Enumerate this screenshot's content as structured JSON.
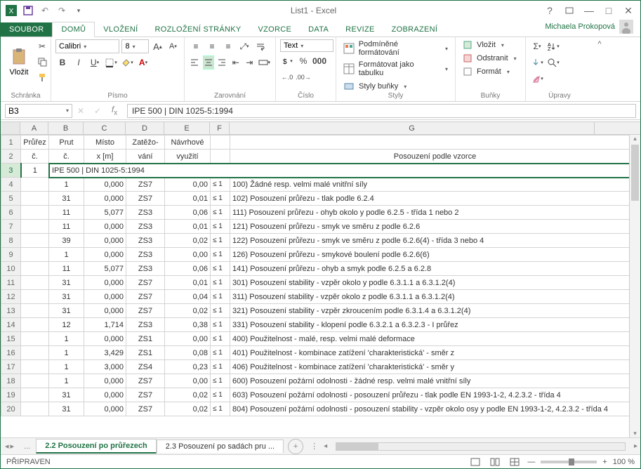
{
  "title": "List1 - Excel",
  "user": "Michaela Prokopová",
  "tabs": {
    "file": "SOUBOR",
    "home": "DOMŮ",
    "insert": "VLOŽENÍ",
    "layout": "ROZLOŽENÍ STRÁNKY",
    "formulas": "VZORCE",
    "data": "DATA",
    "review": "REVIZE",
    "view": "ZOBRAZENÍ"
  },
  "ribbon": {
    "clipboard": {
      "paste": "Vložit",
      "label": "Schránka"
    },
    "font": {
      "name": "Calibri",
      "size": "8",
      "label": "Písmo"
    },
    "align": {
      "label": "Zarovnání"
    },
    "number": {
      "format": "Text",
      "label": "Číslo"
    },
    "styles": {
      "cf": "Podmíněné formátování",
      "tbl": "Formátovat jako tabulku",
      "cell": "Styly buňky",
      "label": "Styly"
    },
    "cells": {
      "ins": "Vložit",
      "del": "Odstranit",
      "fmt": "Formát",
      "label": "Buňky"
    },
    "editing": {
      "label": "Úpravy"
    }
  },
  "namebox": "B3",
  "formula": "IPE 500 | DIN 1025-5:1994",
  "cols": [
    "A",
    "B",
    "C",
    "D",
    "E",
    "F",
    "G"
  ],
  "colW": {
    "A": 40,
    "B": 50,
    "C": 60,
    "D": 55,
    "E": 65,
    "F": 28,
    "G": 520
  },
  "hdr1": {
    "A": "Průřez",
    "B": "Prut",
    "C": "Místo",
    "D": "Zatěžo-",
    "E": "Návrhové",
    "G": ""
  },
  "hdr2": {
    "A": "č.",
    "B": "č.",
    "C": "x [m]",
    "D": "vání",
    "E": "využití",
    "G": "Posouzení podle vzorce"
  },
  "row3": {
    "A": "1",
    "merged": "IPE 500 | DIN 1025-5:1994"
  },
  "rows": [
    {
      "n": 4,
      "B": "1",
      "C": "0,000",
      "D": "ZS7",
      "E": "0,00",
      "F": "≤ 1",
      "G": "100) Žádné resp. velmi malé vnitřní síly"
    },
    {
      "n": 5,
      "B": "31",
      "C": "0,000",
      "D": "ZS7",
      "E": "0,01",
      "F": "≤ 1",
      "G": "102) Posouzení průřezu - tlak podle 6.2.4"
    },
    {
      "n": 6,
      "B": "11",
      "C": "5,077",
      "D": "ZS3",
      "E": "0,06",
      "F": "≤ 1",
      "G": "111) Posouzení průřezu - ohyb okolo y podle 6.2.5 - třída 1 nebo 2"
    },
    {
      "n": 7,
      "B": "11",
      "C": "0,000",
      "D": "ZS3",
      "E": "0,01",
      "F": "≤ 1",
      "G": "121) Posouzení průřezu - smyk ve směru z podle 6.2.6"
    },
    {
      "n": 8,
      "B": "39",
      "C": "0,000",
      "D": "ZS3",
      "E": "0,02",
      "F": "≤ 1",
      "G": "122) Posouzení průřezu - smyk ve směru z podle 6.2.6(4) - třída 3 nebo 4"
    },
    {
      "n": 9,
      "B": "1",
      "C": "0,000",
      "D": "ZS3",
      "E": "0,00",
      "F": "≤ 1",
      "G": "126) Posouzení průřezu - smykové boulení podle 6.2.6(6)"
    },
    {
      "n": 10,
      "B": "11",
      "C": "5,077",
      "D": "ZS3",
      "E": "0,06",
      "F": "≤ 1",
      "G": "141) Posouzení průřezu - ohyb a smyk podle 6.2.5 a 6.2.8"
    },
    {
      "n": 11,
      "B": "31",
      "C": "0,000",
      "D": "ZS7",
      "E": "0,01",
      "F": "≤ 1",
      "G": "301) Posouzení stability - vzpěr okolo y podle 6.3.1.1 a 6.3.1.2(4)"
    },
    {
      "n": 12,
      "B": "31",
      "C": "0,000",
      "D": "ZS7",
      "E": "0,04",
      "F": "≤ 1",
      "G": "311) Posouzení stability - vzpěr okolo z podle 6.3.1.1 a 6.3.1.2(4)"
    },
    {
      "n": 13,
      "B": "31",
      "C": "0,000",
      "D": "ZS7",
      "E": "0,02",
      "F": "≤ 1",
      "G": "321) Posouzení stability - vzpěr zkroucením podle 6.3.1.4 a 6.3.1.2(4)"
    },
    {
      "n": 14,
      "B": "12",
      "C": "1,714",
      "D": "ZS3",
      "E": "0,38",
      "F": "≤ 1",
      "G": "331) Posouzení stability - klopení podle 6.3.2.1 a 6.3.2.3 - I průřez"
    },
    {
      "n": 15,
      "B": "1",
      "C": "0,000",
      "D": "ZS1",
      "E": "0,00",
      "F": "≤ 1",
      "G": "400) Použitelnost - malé, resp. velmi malé deformace"
    },
    {
      "n": 16,
      "B": "1",
      "C": "3,429",
      "D": "ZS1",
      "E": "0,08",
      "F": "≤ 1",
      "G": "401) Použitelnost - kombinace zatížení 'charakteristická' - směr z"
    },
    {
      "n": 17,
      "B": "1",
      "C": "3,000",
      "D": "ZS4",
      "E": "0,23",
      "F": "≤ 1",
      "G": "406) Použitelnost - kombinace zatížení 'charakteristická' - směr y"
    },
    {
      "n": 18,
      "B": "1",
      "C": "0,000",
      "D": "ZS7",
      "E": "0,00",
      "F": "≤ 1",
      "G": "600) Posouzení požární odolnosti - žádné resp. velmi malé vnitřní síly"
    },
    {
      "n": 19,
      "B": "31",
      "C": "0,000",
      "D": "ZS7",
      "E": "0,02",
      "F": "≤ 1",
      "G": "603) Posouzení požární odolnosti - posouzení průřezu - tlak podle EN 1993-1-2, 4.2.3.2 - třída 4"
    },
    {
      "n": 20,
      "B": "31",
      "C": "0,000",
      "D": "ZS7",
      "E": "0,02",
      "F": "≤ 1",
      "G": "804) Posouzení požární odolnosti - posouzení stability - vzpěr okolo osy y podle EN 1993-1-2, 4.2.3.2 - třída 4"
    }
  ],
  "sheets": {
    "s1": "2.2 Posouzení po průřezech",
    "s2": "2.3 Posouzení po sadách pru",
    "ellip": "..."
  },
  "status": {
    "ready": "PŘIPRAVEN",
    "zoom": "100 %"
  }
}
